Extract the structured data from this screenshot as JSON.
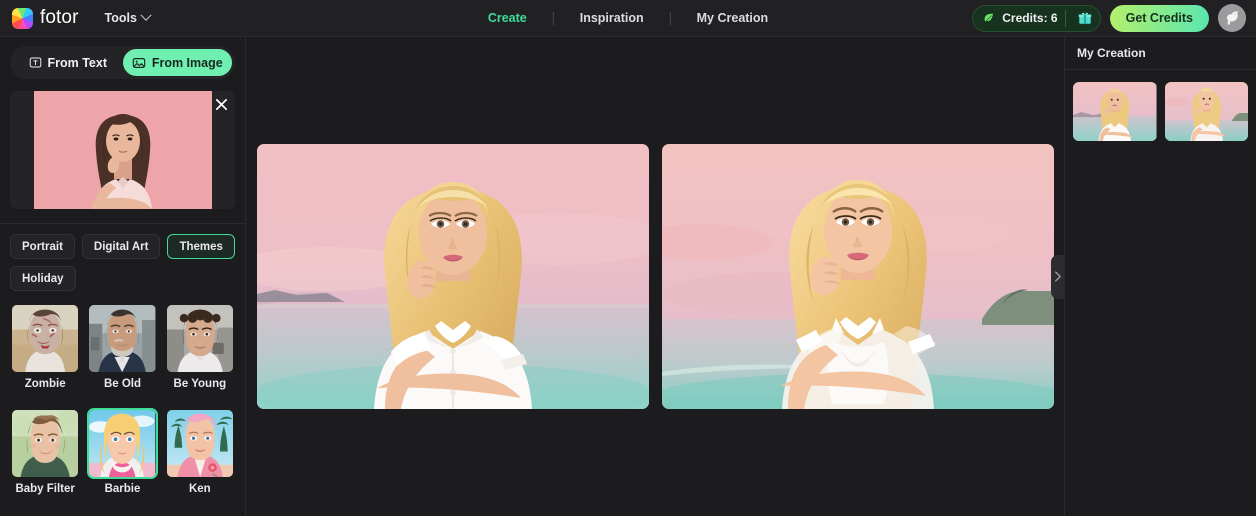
{
  "header": {
    "brand": "fotor",
    "logo_icon": "fotor-color-wheel-logo",
    "tools_label": "Tools",
    "tools_chevron_icon": "chevron-down-icon",
    "nav": [
      {
        "label": "Create",
        "active": true
      },
      {
        "label": "Inspiration",
        "active": false
      },
      {
        "label": "My Creation",
        "active": false
      }
    ],
    "credits": {
      "leaf_icon": "leaf-icon",
      "label": "Credits: 6",
      "value": 6,
      "gift_icon": "gift-icon"
    },
    "get_credits_label": "Get Credits",
    "avatar_icon": "user-avatar-bird-icon"
  },
  "left_panel": {
    "modes": [
      {
        "label": "From Text",
        "icon": "text-box-icon",
        "active": false
      },
      {
        "label": "From Image",
        "icon": "image-icon",
        "active": true
      }
    ],
    "upload": {
      "close_icon": "close-icon",
      "image_alt": "uploaded-portrait-woman-pink-background"
    },
    "category_tabs": [
      {
        "label": "Portrait",
        "active": false
      },
      {
        "label": "Digital Art",
        "active": false
      },
      {
        "label": "Themes",
        "active": true
      },
      {
        "label": "Holiday",
        "active": false
      }
    ],
    "styles": [
      {
        "name": "Zombie",
        "selected": false
      },
      {
        "name": "Be Old",
        "selected": false
      },
      {
        "name": "Be Young",
        "selected": false
      },
      {
        "name": "Baby Filter",
        "selected": false
      },
      {
        "name": "Barbie",
        "selected": true
      },
      {
        "name": "Ken",
        "selected": false
      }
    ]
  },
  "canvas": {
    "results": [
      {
        "alt": "generated-barbie-portrait-1"
      },
      {
        "alt": "generated-barbie-portrait-2"
      }
    ],
    "collapse_icon": "chevron-right-icon"
  },
  "right_panel": {
    "title": "My Creation",
    "creations": [
      {
        "alt": "creation-thumbnail-1"
      },
      {
        "alt": "creation-thumbnail-2"
      }
    ]
  },
  "colors": {
    "accent_green": "#3ddc97",
    "mint": "#6ff0b0",
    "bg": "#1c1c1e",
    "panel": "#212124",
    "chip": "#242427"
  }
}
